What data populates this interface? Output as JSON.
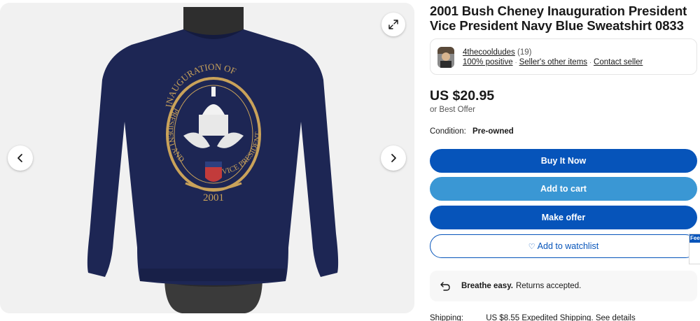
{
  "listing": {
    "title": "2001 Bush Cheney Inauguration President Vice President Navy Blue Sweatshirt 0833",
    "price": "US $20.95",
    "best_offer": "or Best Offer",
    "condition_label": "Condition:",
    "condition_value": "Pre-owned"
  },
  "seller": {
    "name": "4thecooldudes",
    "count": "(19)",
    "positive": "100% positive",
    "other_items": "Seller's other items",
    "contact": "Contact seller"
  },
  "buttons": {
    "buy_now": "Buy It Now",
    "add_to_cart": "Add to cart",
    "make_offer": "Make offer",
    "watchlist": "Add to watchlist"
  },
  "returns": {
    "strong": "Breathe easy.",
    "text": "Returns accepted."
  },
  "shipping": {
    "label": "Shipping:",
    "value": "US $8.55 Expedited Shipping. See details"
  },
  "graphic": {
    "seal_text_top": "INAUGURATION OF",
    "seal_text_left": "PRESIDENT AND",
    "seal_text_right": "VICE PRESIDENT",
    "seal_year": "2001"
  },
  "feedback_tab": "Fee",
  "icons": {
    "prev": "chevron-left-icon",
    "next": "chevron-right-icon",
    "expand": "expand-icon",
    "heart": "heart-icon",
    "returns": "returns-icon"
  },
  "colors": {
    "primary_blue": "#0654ba",
    "cart_blue": "#3a97d4",
    "sweatshirt_navy": "#1d2654",
    "seal_gold": "#c9a25a"
  }
}
